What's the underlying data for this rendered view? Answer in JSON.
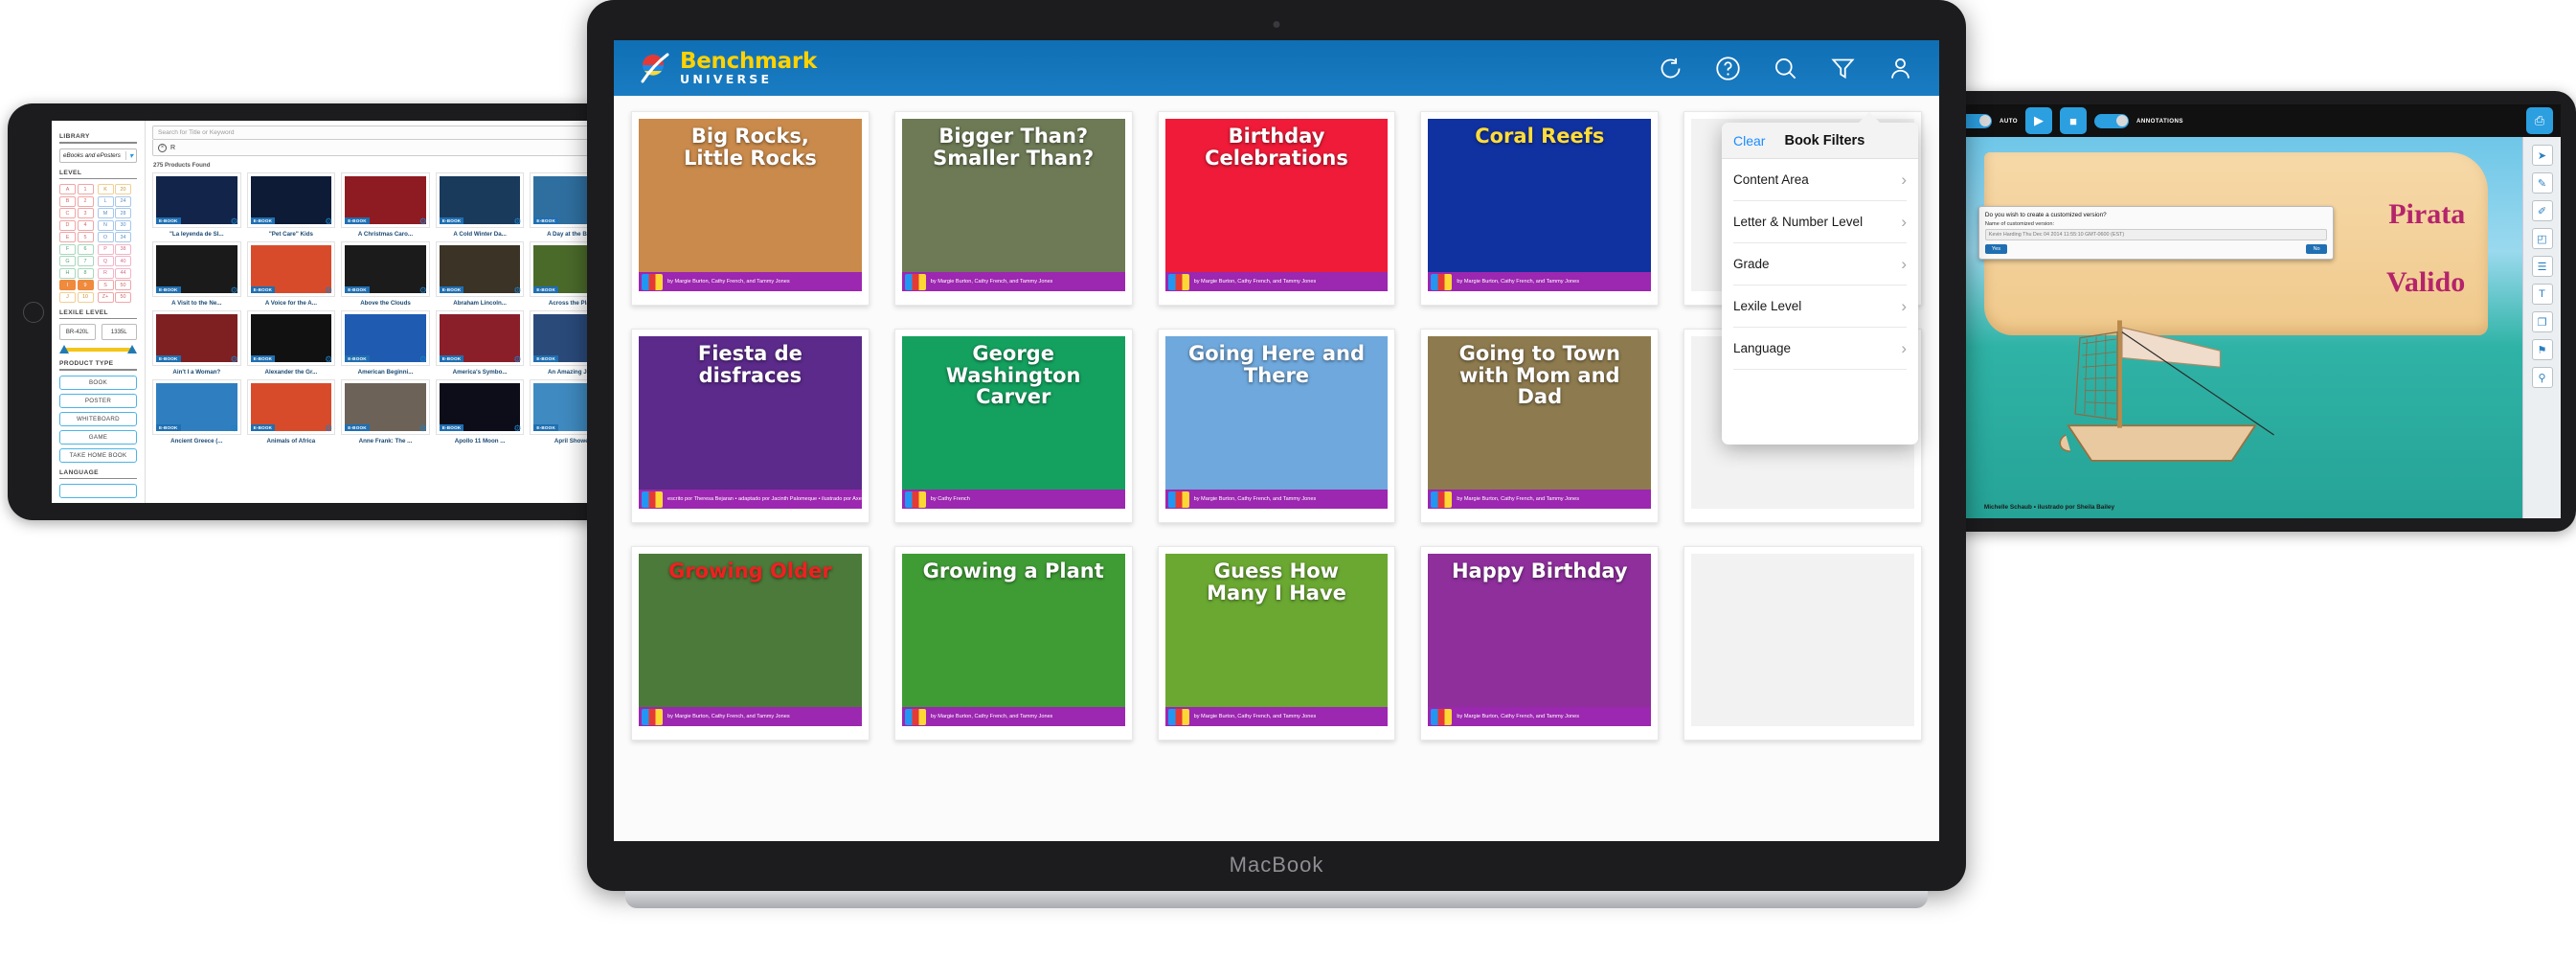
{
  "macbook": {
    "brand_label": "MacBook",
    "header": {
      "logo_main": "Benchmark",
      "logo_sub": "UNIVERSE",
      "icons": [
        {
          "name": "refresh-icon",
          "glyph": "↻"
        },
        {
          "name": "help-icon",
          "glyph": "?"
        },
        {
          "name": "search-icon",
          "glyph": "⚲"
        },
        {
          "name": "filter-icon",
          "glyph": "▽"
        },
        {
          "name": "user-profile-icon",
          "glyph": "♟"
        }
      ]
    },
    "books": [
      {
        "title": "Big Rocks,\nLittle Rocks",
        "author": "by Margie Burton, Cathy French, and Tammy Jones",
        "bg": "#c98a4b",
        "title_color": "#ffffff"
      },
      {
        "title": "Bigger Than?\nSmaller Than?",
        "author": "by Margie Burton, Cathy French, and Tammy Jones",
        "bg": "#6d7a55",
        "title_color": "#ffffff"
      },
      {
        "title": "Birthday\nCelebrations",
        "author": "by Margie Burton, Cathy French, and Tammy Jones",
        "bg": "#ef1b38",
        "title_color": "#ffffff"
      },
      {
        "title": "Coral Reefs",
        "author": "by Margie Burton, Cathy French, and Tammy Jones",
        "bg": "#1031a0",
        "title_color": "#ffdd3c"
      },
      {
        "title": "",
        "author": "",
        "bg": "#f2f2f2",
        "title_color": "#ffffff"
      },
      {
        "title": "Fiesta de disfraces",
        "author": "escrito por Theresa Bejaran • adaptado por Jacinth Palomeque • ilustrado por Axel Scheffler",
        "bg": "#5b2a8a",
        "title_color": "#ffffff"
      },
      {
        "title": "George Washington\nCarver",
        "author": "by Cathy French",
        "bg": "#14a05e",
        "title_color": "#ffffff"
      },
      {
        "title": "Going Here and There",
        "author": "by Margie Burton, Cathy French, and Tammy Jones",
        "bg": "#6fa8dc",
        "title_color": "#ffffff"
      },
      {
        "title": "Going to Town\nwith Mom and Dad",
        "author": "by Margie Burton, Cathy French, and Tammy Jones",
        "bg": "#8d7a4e",
        "title_color": "#ffffff"
      },
      {
        "title": "",
        "author": "",
        "bg": "#f2f2f2",
        "title_color": "#ffffff"
      },
      {
        "title": "Growing Older",
        "author": "by Margie Burton, Cathy French, and Tammy Jones",
        "bg": "#4c7a3a",
        "title_color": "#ef2020"
      },
      {
        "title": "Growing a Plant",
        "author": "by Margie Burton, Cathy French, and Tammy Jones",
        "bg": "#3f9c35",
        "title_color": "#ffffff"
      },
      {
        "title": "Guess How\nMany I Have",
        "author": "by Margie Burton, Cathy French, and Tammy Jones",
        "bg": "#6aa832",
        "title_color": "#ffffff"
      },
      {
        "title": "Happy Birthday",
        "author": "by Margie Burton, Cathy French, and Tammy Jones",
        "bg": "#8e2f9c",
        "title_color": "#ffffff"
      },
      {
        "title": "",
        "author": "",
        "bg": "#f2f2f2",
        "title_color": "#ffffff"
      }
    ],
    "filter_panel": {
      "clear_label": "Clear",
      "title": "Book Filters",
      "items": [
        {
          "label": "Content Area",
          "chevron": "›"
        },
        {
          "label": "Letter & Number Level",
          "chevron": "›"
        },
        {
          "label": "Grade",
          "chevron": "›"
        },
        {
          "label": "Lexile Level",
          "chevron": "›"
        },
        {
          "label": "Language",
          "chevron": "›"
        }
      ]
    }
  },
  "ipad": {
    "sidebar": {
      "library_heading": "LIBRARY",
      "library_value": "eBooks and ePosters",
      "library_chevron": "▾",
      "level_heading": "LEVEL",
      "level_left": [
        [
          "A",
          "1"
        ],
        [
          "B",
          "2"
        ],
        [
          "C",
          "3"
        ],
        [
          "D",
          "4"
        ],
        [
          "E",
          "5"
        ],
        [
          "F",
          "6"
        ],
        [
          "G",
          "7"
        ],
        [
          "H",
          "8"
        ],
        [
          "I",
          "9"
        ],
        [
          "J",
          "10"
        ]
      ],
      "level_right": [
        [
          "K",
          "20"
        ],
        [
          "L",
          "24"
        ],
        [
          "M",
          "28"
        ],
        [
          "N",
          "30"
        ],
        [
          "O",
          "34"
        ],
        [
          "P",
          "38"
        ],
        [
          "Q",
          "40"
        ],
        [
          "R",
          "44"
        ],
        [
          "S",
          "50"
        ],
        [
          "Z+",
          "50"
        ]
      ],
      "lexile_heading": "LEXILE LEVEL",
      "lexile_min": "BR-420L",
      "lexile_max": "1335L",
      "product_heading": "PRODUCT TYPE",
      "product_types": [
        "BOOK",
        "POSTER",
        "WHITEBOARD",
        "GAME",
        "TAKE HOME BOOK"
      ],
      "language_heading": "LANGUAGE"
    },
    "search_placeholder": "Search for Title or Keyword",
    "chip_label": "R",
    "chip_close": "×",
    "results_count": "275 Products Found",
    "badge_label": "E-BOOK",
    "gear_glyph": "⚙",
    "books": [
      {
        "title": "\"La leyenda de Sl...",
        "bg": "#12244a"
      },
      {
        "title": "\"Pet Care\" Kids",
        "bg": "#0d1b36"
      },
      {
        "title": "A Christmas Caro...",
        "bg": "#8e1b22"
      },
      {
        "title": "A Cold Winter Da...",
        "bg": "#1a3a5c"
      },
      {
        "title": "A Day at the Beac...",
        "bg": "#2f6fa0"
      },
      {
        "title": "A Visit to the Ne...",
        "bg": "#1a1a1a"
      },
      {
        "title": "A Voice for the A...",
        "bg": "#d84b2a"
      },
      {
        "title": "Above the Clouds",
        "bg": "#1b1b1b"
      },
      {
        "title": "Abraham Lincoln...",
        "bg": "#3a3326"
      },
      {
        "title": "Across the Plain...",
        "bg": "#4a6a2a"
      },
      {
        "title": "Ain't I a Woman?",
        "bg": "#7e1f22"
      },
      {
        "title": "Alexander the Gr...",
        "bg": "#111111"
      },
      {
        "title": "American Beginni...",
        "bg": "#1f5bb0"
      },
      {
        "title": "America's Symbo...",
        "bg": "#8a1f2a"
      },
      {
        "title": "An Amazing Jour...",
        "bg": "#2a4a7a"
      },
      {
        "title": "Ancient Greece (...",
        "bg": "#2f7fc0"
      },
      {
        "title": "Animals of Africa",
        "bg": "#d84b2a"
      },
      {
        "title": "Anne Frank: The ...",
        "bg": "#6d6258"
      },
      {
        "title": "Apollo 11 Moon ...",
        "bg": "#0d0d1a"
      },
      {
        "title": "April Showers",
        "bg": "#3f8ac0"
      }
    ]
  },
  "tablet": {
    "toolbar": {
      "auto_label": "AUTO",
      "annotations_label": "ANNOTATIONS",
      "play_glyph": "▶",
      "stop_glyph": "■",
      "print_glyph": "⎙"
    },
    "page": {
      "title_line1": "Pirata",
      "title_line2": "Valido",
      "caption": "Michelle Schaub • ilustrado por Sheila Bailey"
    },
    "dialog": {
      "question": "Do you wish to create a customized version?",
      "field_label": "Name of customized version:",
      "field_value": "Kevin Harding Thu Dec 04 2014 11:55:10 GMT-0600 (EST)",
      "yes_label": "Yes",
      "no_label": "No"
    },
    "rail_icons": [
      {
        "name": "cursor-icon",
        "glyph": "➤"
      },
      {
        "name": "pen-icon",
        "glyph": "✎"
      },
      {
        "name": "highlighter-icon",
        "glyph": "✐"
      },
      {
        "name": "eraser-icon",
        "glyph": "◰"
      },
      {
        "name": "note-icon",
        "glyph": "☰"
      },
      {
        "name": "text-icon",
        "glyph": "T"
      },
      {
        "name": "page-icon",
        "glyph": "❐"
      },
      {
        "name": "bookmark-icon",
        "glyph": "⚑"
      },
      {
        "name": "zoom-icon",
        "glyph": "⚲"
      }
    ]
  }
}
